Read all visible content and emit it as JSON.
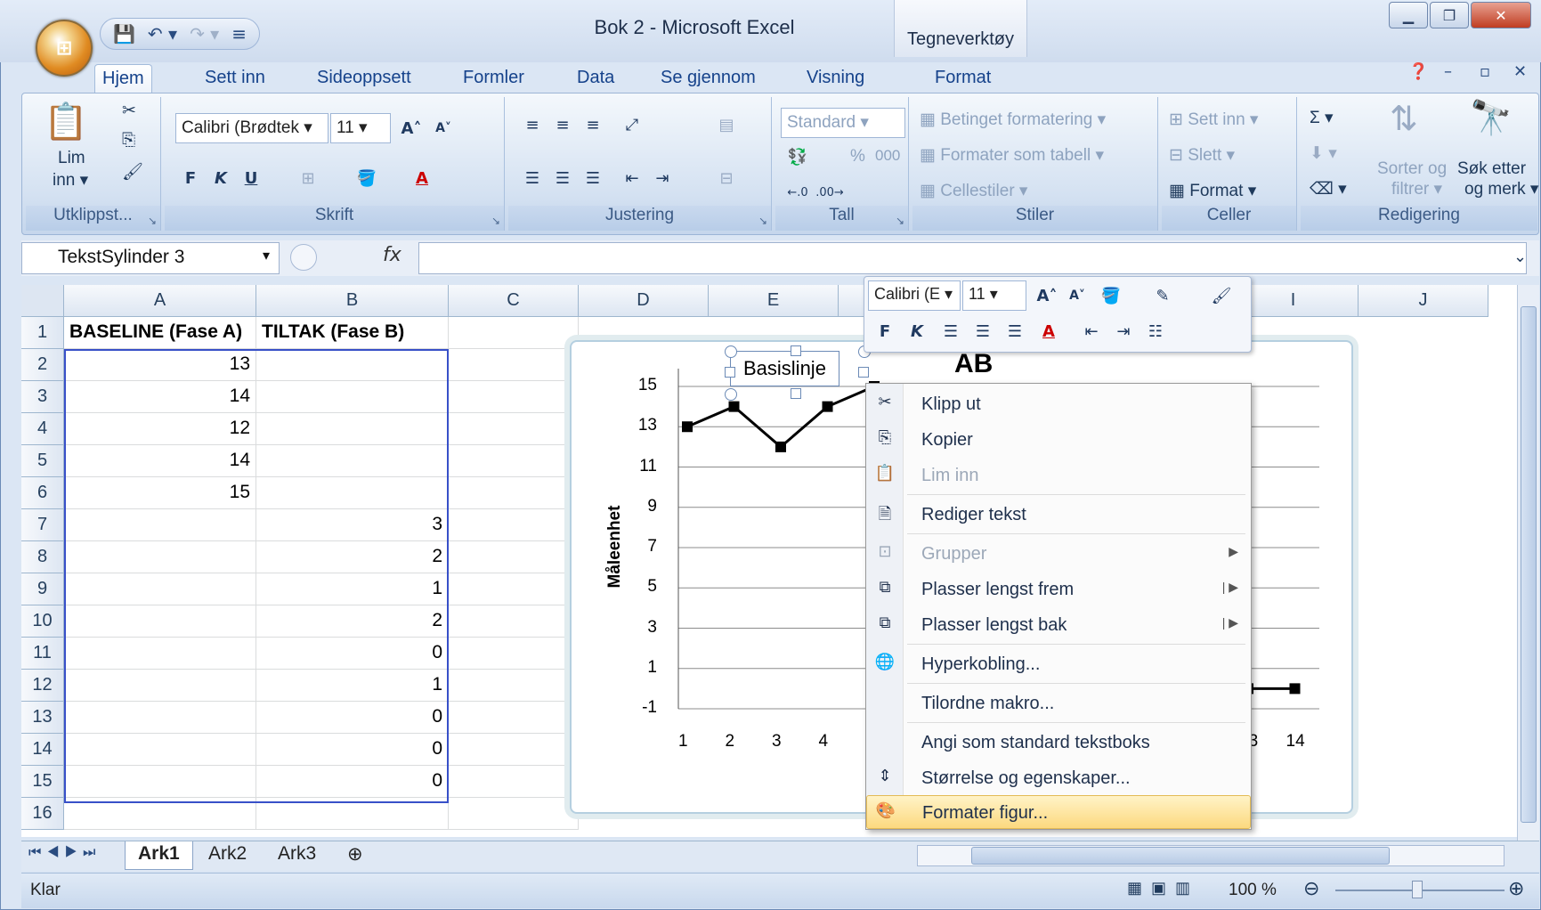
{
  "window": {
    "title": "Bok 2 - Microsoft Excel",
    "contextual_group": "Tegneverktøy"
  },
  "tabs": [
    "Hjem",
    "Sett inn",
    "Sideoppsett",
    "Formler",
    "Data",
    "Se gjennom",
    "Visning",
    "Format"
  ],
  "ribbon": {
    "clipboard": {
      "paste": "Lim",
      "paste2": "inn",
      "label": "Utklippst..."
    },
    "font": {
      "name": "Calibri (Brødtek",
      "size": "11",
      "bold": "F",
      "italic": "K",
      "underline": "U",
      "label": "Skrift"
    },
    "alignment": {
      "label": "Justering"
    },
    "number": {
      "format": "Standard",
      "percent": "%",
      "thousands": "000",
      "label": "Tall"
    },
    "styles": {
      "conditional": "Betinget formatering",
      "as_table": "Formater som tabell",
      "cell_styles": "Cellestiler",
      "label": "Stiler"
    },
    "cells": {
      "insert": "Sett inn",
      "delete": "Slett",
      "format": "Format",
      "label": "Celler"
    },
    "editing": {
      "sum": "Σ",
      "sort": "Sorter og",
      "sort2": "filtrer",
      "find": "Søk etter",
      "find2": "og merk",
      "label": "Redigering"
    }
  },
  "formula_bar": {
    "name_box": "TekstSylinder 3",
    "fx": "fx",
    "value": ""
  },
  "columns": [
    "A",
    "B",
    "C",
    "D",
    "E",
    "F",
    "G",
    "H",
    "I",
    "J"
  ],
  "rows": [
    "1",
    "2",
    "3",
    "4",
    "5",
    "6",
    "7",
    "8",
    "9",
    "10",
    "11",
    "12",
    "13",
    "14",
    "15",
    "16"
  ],
  "cells": {
    "A1": "BASELINE (Fase A)",
    "B1": "TILTAK (Fase B)",
    "A2": "13",
    "A3": "14",
    "A4": "12",
    "A5": "14",
    "A6": "15",
    "B7": "3",
    "B8": "2",
    "B9": "1",
    "B10": "2",
    "B11": "0",
    "B12": "1",
    "B13": "0",
    "B14": "0",
    "B15": "0"
  },
  "chart_data": {
    "type": "line",
    "ylabel": "Måleenhet",
    "yticks": [
      "15",
      "13",
      "11",
      "9",
      "7",
      "5",
      "3",
      "1",
      "-1"
    ],
    "xticks_visible": [
      "1",
      "2",
      "3",
      "4",
      "13",
      "14"
    ],
    "series": [
      {
        "x": [
          1,
          2,
          3,
          4,
          5
        ],
        "values": [
          13,
          14,
          12,
          14,
          15
        ]
      },
      {
        "x": [
          13,
          14
        ],
        "values": [
          0,
          0
        ]
      }
    ],
    "ylim": [
      -1,
      15
    ],
    "annotations": {
      "textbox": "Basislinje",
      "label_partial": "AB"
    }
  },
  "mini_toolbar": {
    "font": "Calibri (E",
    "size": "11",
    "bold": "F",
    "italic": "K"
  },
  "context_menu": [
    {
      "label": "Klipp ut",
      "icon": "scissors-icon",
      "enabled": true
    },
    {
      "label": "Kopier",
      "icon": "copy-icon",
      "enabled": true
    },
    {
      "label": "Lim inn",
      "icon": "paste-icon",
      "enabled": false
    },
    {
      "label": "Rediger tekst",
      "icon": "edit-text-icon",
      "enabled": true
    },
    {
      "label": "Grupper",
      "icon": "group-icon",
      "enabled": false
    },
    {
      "label": "Plasser lengst frem",
      "icon": "bring-front-icon",
      "enabled": true
    },
    {
      "label": "Plasser lengst bak",
      "icon": "send-back-icon",
      "enabled": true
    },
    {
      "label": "Hyperkobling...",
      "icon": "hyperlink-icon",
      "enabled": true
    },
    {
      "label": "Tilordne makro...",
      "icon": "",
      "enabled": true
    },
    {
      "label": "Angi som standard tekstboks",
      "icon": "",
      "enabled": true
    },
    {
      "label": "Størrelse og egenskaper...",
      "icon": "size-icon",
      "enabled": true
    },
    {
      "label": "Formater figur...",
      "icon": "format-shape-icon",
      "enabled": true,
      "highlighted": true
    }
  ],
  "sheets": [
    "Ark1",
    "Ark2",
    "Ark3"
  ],
  "status": {
    "ready": "Klar",
    "zoom": "100 %"
  }
}
